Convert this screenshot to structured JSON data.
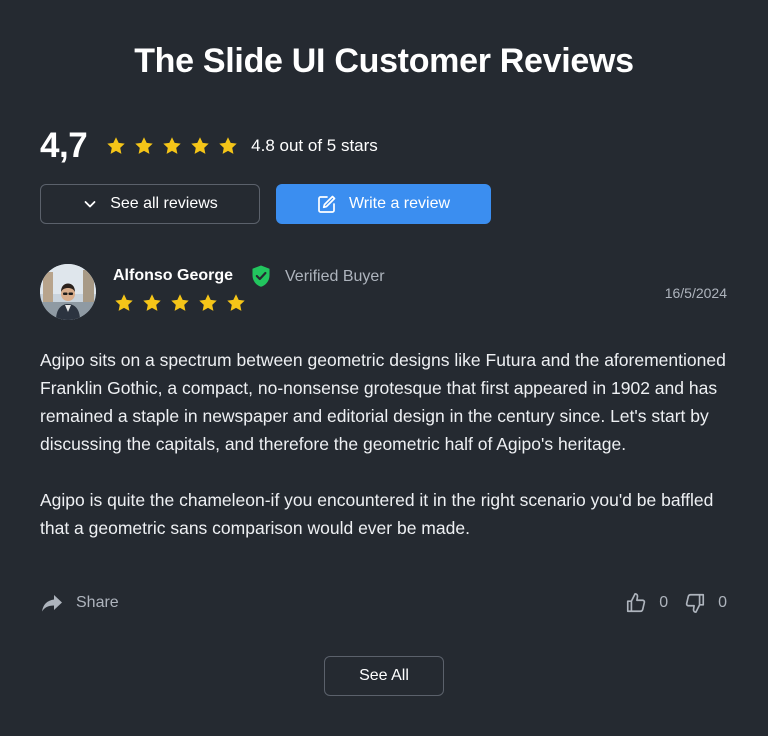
{
  "page_title": "The Slide UI Customer Reviews",
  "summary": {
    "average_rating": "4,7",
    "star_count": 5,
    "rating_text": "4.8 out of 5 stars"
  },
  "buttons": {
    "see_all_reviews": "See all reviews",
    "write_review": "Write a review",
    "see_all": "See All"
  },
  "review": {
    "author": "Alfonso George",
    "verified_label": "Verified Buyer",
    "date": "16/5/2024",
    "stars": 5,
    "paragraphs": [
      "Agipo sits on a spectrum between geometric designs like Futura and the aforementioned Franklin Gothic, a compact, no-nonsense grotesque that first appeared in 1902 and has remained a staple in newspaper and editorial design in the century since. Let's start by discussing the capitals, and therefore the geometric half of Agipo's heritage.",
      "Agipo is quite the chameleon-if you encountered it in the right scenario you'd be baffled that a geometric sans comparison would ever be made."
    ],
    "share_label": "Share",
    "likes": "0",
    "dislikes": "0"
  },
  "colors": {
    "background": "#252a31",
    "star": "#f5c518",
    "primary": "#3b8ef0",
    "verified": "#22c55e",
    "muted_text": "#aeb4bd",
    "border": "#5b616b"
  },
  "icons": [
    "star-icon",
    "chevron-down-icon",
    "edit-icon",
    "verified-badge-icon",
    "share-icon",
    "thumbs-up-icon",
    "thumbs-down-icon"
  ]
}
